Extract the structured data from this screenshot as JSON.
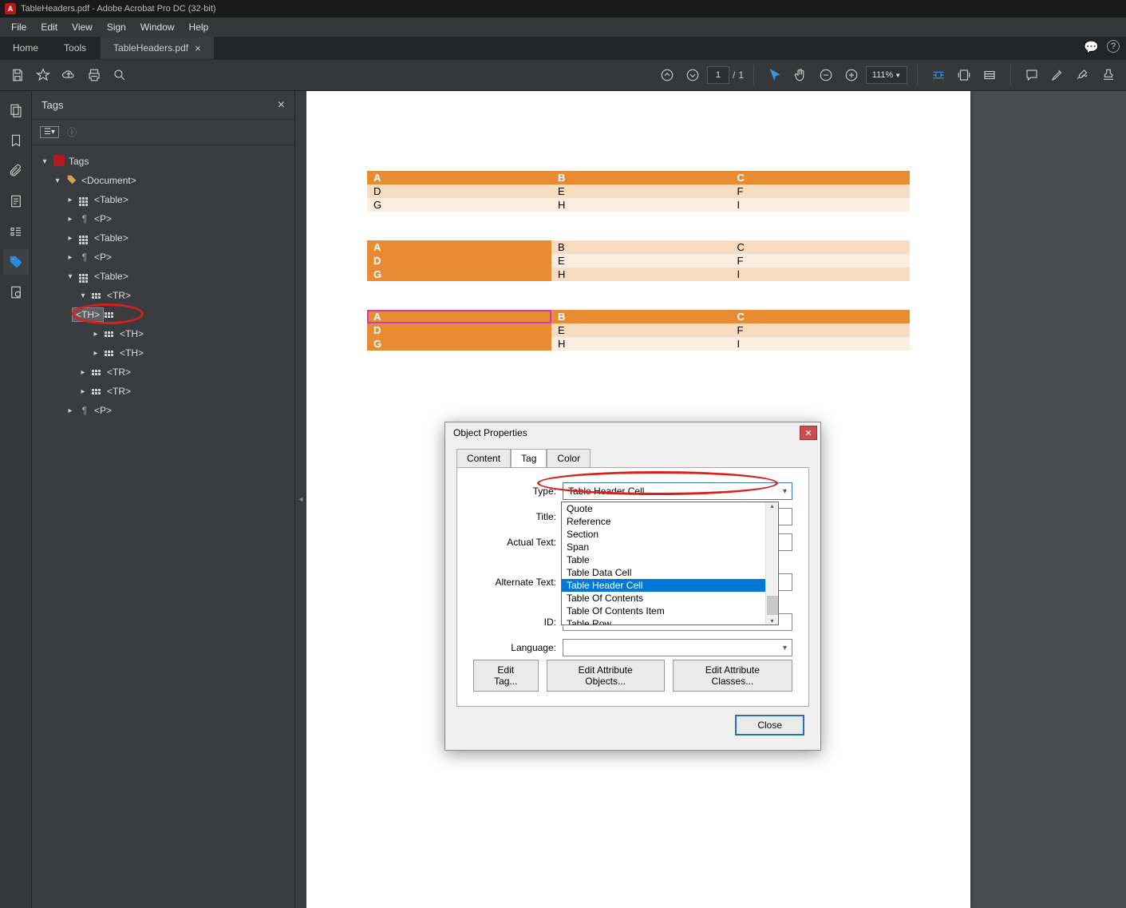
{
  "app": {
    "title_text": "TableHeaders.pdf - Adobe Acrobat Pro DC (32-bit)"
  },
  "menu": [
    "File",
    "Edit",
    "View",
    "Sign",
    "Window",
    "Help"
  ],
  "tabs": {
    "home": "Home",
    "tools": "Tools",
    "doc": "TableHeaders.pdf"
  },
  "toolbar": {
    "page_current": "1",
    "page_sep": "/",
    "page_total": "1",
    "zoom": "111%"
  },
  "panel": {
    "title": "Tags",
    "tree": {
      "root": "Tags",
      "doc": "<Document>",
      "table": "<Table>",
      "p": "<P>",
      "tr": "<TR>",
      "th": "<TH>"
    }
  },
  "tables": [
    {
      "rows": [
        [
          "A",
          "B",
          "C"
        ],
        [
          "D",
          "E",
          "F"
        ],
        [
          "G",
          "H",
          "I"
        ]
      ],
      "style": "header-top"
    },
    {
      "rows": [
        [
          "A",
          "B",
          "C"
        ],
        [
          "D",
          "E",
          "F"
        ],
        [
          "G",
          "H",
          "I"
        ]
      ],
      "style": "header-left"
    },
    {
      "rows": [
        [
          "A",
          "B",
          "C"
        ],
        [
          "D",
          "E",
          "F"
        ],
        [
          "G",
          "H",
          "I"
        ]
      ],
      "style": "header-both"
    }
  ],
  "dialog": {
    "title": "Object Properties",
    "tabs": [
      "Content",
      "Tag",
      "Color"
    ],
    "active_tab": "Tag",
    "labels": {
      "type": "Type:",
      "title": "Title:",
      "actual": "Actual Text:",
      "alt": "Alternate Text:",
      "id": "ID:",
      "lang": "Language:"
    },
    "type_value": "Table Header Cell",
    "dropdown": [
      "Quote",
      "Reference",
      "Section",
      "Span",
      "Table",
      "Table Data Cell",
      "Table Header Cell",
      "Table Of Contents",
      "Table Of Contents Item",
      "Table Row"
    ],
    "buttons": {
      "edit_tag": "Edit Tag...",
      "edit_attr_obj": "Edit Attribute Objects...",
      "edit_attr_cls": "Edit Attribute Classes...",
      "close": "Close"
    }
  }
}
